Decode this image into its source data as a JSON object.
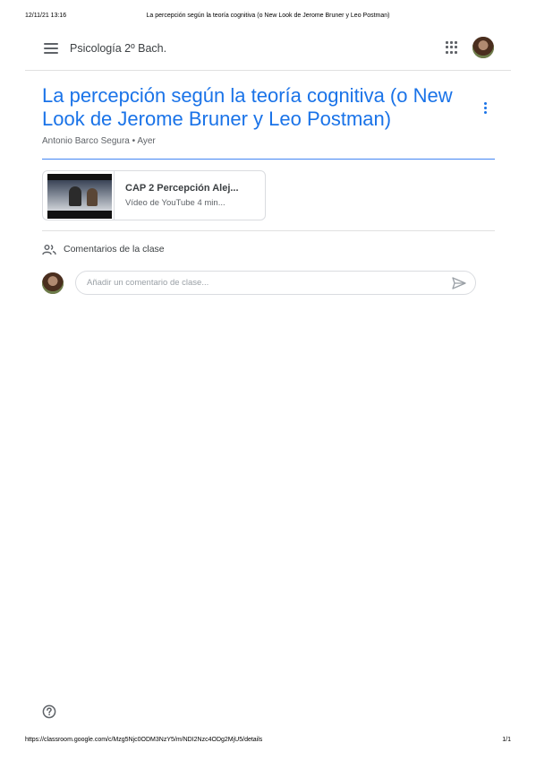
{
  "print_header": {
    "date": "12/11/21 13:16",
    "title": "La percepción según la teoría cognitiva (o New Look de Jerome Bruner y Leo Postman)"
  },
  "topbar": {
    "menu_icon": "hamburger-menu-icon",
    "class_name": "Psicología 2º Bach.",
    "apps_icon": "apps-grid-icon"
  },
  "post": {
    "title": "La percepción según la teoría cognitiva (o New Look de Jerome Bruner y Leo Postman)",
    "meta": "Antonio Barco Segura • Ayer",
    "more_icon": "more-vertical-icon"
  },
  "attachment": {
    "title": "CAP 2 Percepción Alej...",
    "subtitle": "Vídeo de YouTube   4 min..."
  },
  "comments": {
    "icon": "people-icon",
    "label": "Comentarios de la clase",
    "placeholder": "Añadir un comentario de clase...",
    "send_icon": "send-icon"
  },
  "help_icon": "help-icon",
  "print_footer": {
    "url": "https://classroom.google.com/c/Mzg5Njc0ODM3NzY5/m/NDI2Nzc4ODg2MjU5/details",
    "page": "1/1"
  },
  "colors": {
    "accent": "#1a73e8",
    "rule": "#4285f4",
    "border": "#dadce0",
    "text_secondary": "#5f6368"
  }
}
